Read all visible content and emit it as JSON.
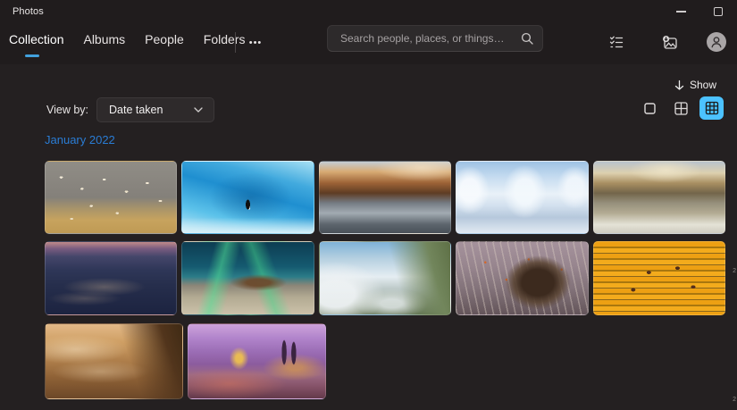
{
  "titlebar": {
    "app_title": "Photos"
  },
  "nav": {
    "tabs": [
      {
        "id": "collection",
        "label": "Collection",
        "active": true
      },
      {
        "id": "albums",
        "label": "Albums",
        "active": false
      },
      {
        "id": "people",
        "label": "People",
        "active": false
      },
      {
        "id": "folders",
        "label": "Folders",
        "active": false
      }
    ],
    "more_label": "•••"
  },
  "search": {
    "placeholder": "Search people, places, or things…"
  },
  "toolbar_icons": [
    "multiselect-icon",
    "import-icon",
    "account-icon"
  ],
  "show": {
    "label": "Show"
  },
  "view_by": {
    "label": "View by:",
    "selected": "Date taken"
  },
  "view_sizes": {
    "options": [
      "large",
      "medium",
      "small"
    ],
    "selected": "small"
  },
  "section": {
    "title": "January 2022"
  },
  "scroll_hints": [
    "2",
    "2"
  ],
  "colors": {
    "accent": "#4cc2ff",
    "tab_underline": "#42a1dd",
    "date_header": "#2a7cd4",
    "header_band": "#201c1d",
    "content_bg": "#242021"
  },
  "photos": {
    "rows": [
      {
        "tiles": [
          {
            "name": "birds-on-shore",
            "bg": "radial-gradient(3px 2px at 12% 22%, #f2ead8 60%, transparent 62%), radial-gradient(3px 2px at 28% 38%, #efe6d2 60%, transparent 62%), radial-gradient(3px 2px at 45% 25%, #f4ecd8 60%, transparent 62%), radial-gradient(3px 2px at 62% 42%, #efe4cc 60%, transparent 62%), radial-gradient(3px 2px at 78% 30%, #f2e8d4 60%, transparent 62%), radial-gradient(3px 2px at 88% 55%, #eee2ca 60%, transparent 62%), radial-gradient(3px 2px at 35% 62%, #f0e6d0 60%, transparent 62%), radial-gradient(3px 2px at 55% 72%, #ece0c6 60%, transparent 62%), radial-gradient(3px 2px at 20% 80%, #eadcc0 60%, transparent 62%), linear-gradient(180deg, #908d86 0%, #84807a 50%, #a9946a 66%, #c7a35e 82%, #bf9a54 100%)"
          },
          {
            "name": "penguin-ice-cave",
            "bg": "radial-gradient(4px 9px at 50% 60%, #101010 58%, transparent 64%), radial-gradient(2px 6px at 51% 63%, #f8f8f8 55%, transparent 62%), radial-gradient(45% 50% at 52% 50%, rgba(10,90,150,0.5) 0%, transparent 70%), linear-gradient(0deg, #d8f0f8 0%, rgba(216,240,248,0) 22%), linear-gradient(15deg, #bfe8f6 0%, #5cc2ea 25%, #1f8fd0 55%, #42aade 75%, #a6e0f4 100%)"
          },
          {
            "name": "glacier-valley-sunset",
            "bg": "radial-gradient(55% 30% at 78% 8%, rgba(240,220,190,0.85) 0%, transparent 65%), linear-gradient(180deg, #c3ccd4 0%, #d8ab74 14%, #9c6236 30%, #5e3c24 44%, #757c84 58%, #a2abb2 72%, #5c646c 88%, #495058 100%)"
          },
          {
            "name": "frosty-river-trees",
            "bg": "radial-gradient(20% 45% at 10% 40%, rgba(248,251,254,0.9) 35%, transparent 75%), radial-gradient(22% 50% at 52% 42%, rgba(244,249,253,0.9) 35%, transparent 75%), radial-gradient(18% 40% at 90% 36%, rgba(242,247,252,0.9) 35%, transparent 75%), linear-gradient(180deg, #9fc2e4 0%, #c6dcf0 22%, #e9f1f8 45%, #d2e0ee 62%, #b6c8dc 78%, #e2eaf2 100%)"
          },
          {
            "name": "winter-lake-village",
            "bg": "radial-gradient(40% 25% at 55% 12%, rgba(238,228,200,0.9) 0%, transparent 70%), linear-gradient(180deg, #b9c2cc 0%, #ddd0ae 16%, #a98f62 30%, #73654a 44%, #96907c 58%, #b3ab93 72%, #e4e2d6 88%, #cfccc0 100%)"
          }
        ]
      },
      {
        "tiles": [
          {
            "name": "winding-mountain-road",
            "bg": "radial-gradient(45% 18% at 45% 62%, rgba(226,196,156,0.3) 0%, transparent 70%), radial-gradient(40% 14% at 30% 78%, rgba(226,196,156,0.22) 0%, transparent 70%), linear-gradient(180deg, #c08a8a 0%, #7a5c80 9%, #45466a 20%, #2f3758 38%, #262e4c 60%, #1c2340 100%)"
          },
          {
            "name": "aurora-shipwreck",
            "bg": "radial-gradient(30% 16% at 58% 56%, rgba(108,74,44,0.95) 30%, transparent 72%), linear-gradient(105deg, transparent 22%, rgba(80,225,150,0.55) 30%, transparent 40%), linear-gradient(70deg, transparent 52%, rgba(70,215,140,0.5) 60%, transparent 70%), linear-gradient(180deg, #0d3d52 0%, #155a70 34%, #2c7c88 48%, #8c8678 60%, #b2aa92 76%, #ccc2aa 100%)"
          },
          {
            "name": "misty-karst-peak",
            "bg": "linear-gradient(255deg, #5e7046 0%, #72865c 16%, rgba(114,134,92,0) 42%), radial-gradient(50% 60% at 12% 72%, rgba(238,242,244,0.95) 30%, transparent 75%), radial-gradient(40% 30% at 55% 85%, rgba(230,236,238,0.8) 20%, transparent 70%), linear-gradient(180deg, #7fb2d8 0%, #b4cfe0 22%, #e5edf2 48%, #b9c6c4 66%, #84947a 84%, #5e7050 100%)"
          },
          {
            "name": "porcupine-in-branches",
            "bg": "radial-gradient(32% 48% at 62% 56%, #3c2a1e 38%, rgba(90,68,50,0.85) 58%, transparent 78%), radial-gradient(2px 2px at 22% 28%, #d5682a 60%, transparent 64%), radial-gradient(2px 2px at 38% 52%, #cc6226 60%, transparent 64%), radial-gradient(2px 2px at 55% 24%, #d06828 60%, transparent 64%), radial-gradient(2px 2px at 80% 38%, #c85e24 60%, transparent 64%), repeating-linear-gradient(78deg, rgba(216,202,192,0.42) 0 1.5px, rgba(216,202,192,0) 1.5px 8px), linear-gradient(180deg, #a5929c 0%, #97858e 34%, #83737a 64%, #64555a 100%)"
          },
          {
            "name": "golden-rice-terraces",
            "bg": "radial-gradient(4px 3px at 42% 42%, #53301c 60%, transparent 66%), radial-gradient(4px 3px at 64% 36%, #4e2c1a 60%, transparent 66%), radial-gradient(4px 3px at 76% 62%, #552f1c 60%, transparent 66%), radial-gradient(4px 3px at 30% 66%, #502d1a 60%, transparent 66%), repeating-linear-gradient(180deg, #eda013 0 5px, #a9770e 5px 7px, #f3ab1c 7px 12px, #8a661c 12px 13px)"
          }
        ]
      },
      {
        "tiles": [
          {
            "name": "desert-fortress-storm",
            "bg": "linear-gradient(252deg, #3f2a14 0%, #52351c 14%, rgba(82,53,28,0) 40%), radial-gradient(55% 28% at 22% 34%, rgba(244,224,192,0.55) 0%, transparent 70%), radial-gradient(50% 22% at 40% 64%, rgba(238,214,178,0.4) 0%, transparent 70%), linear-gradient(180deg, #e2b988 0%, #cf9f64 24%, #b0804c 48%, #8e6136 72%, #6d4828 100%)"
          },
          {
            "name": "purple-winter-city",
            "bg": "radial-gradient(3% 28% at 70% 38%, #3c2542 55%, transparent 62%), radial-gradient(3% 26% at 77% 39%, #3a2340 55%, transparent 62%), radial-gradient(10% 22% at 37% 46%, rgba(242,196,74,0.9) 25%, transparent 70%), radial-gradient(34% 26% at 78% 58%, rgba(234,170,56,0.55) 15%, transparent 70%), radial-gradient(60% 30% at 30% 80%, rgba(222,120,90,0.5) 0%, transparent 70%), linear-gradient(180deg, #cda2da 0%, #b285cc 18%, #9a6cb4 38%, #8c5c9e 54%, #9d6a84 68%, #855268 84%, #64394a 100%)"
          }
        ]
      }
    ]
  }
}
